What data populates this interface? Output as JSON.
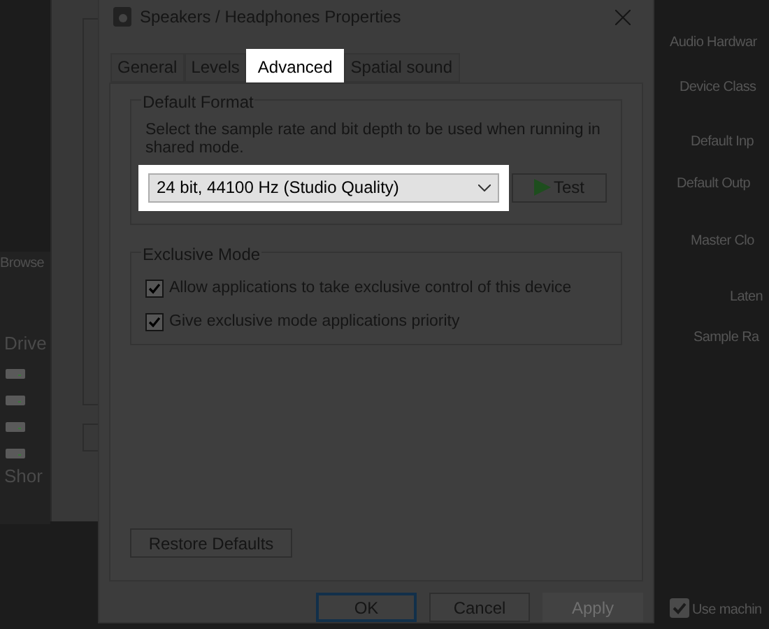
{
  "background_left": {
    "button": "Browse",
    "sidebar_heading": "Drive",
    "drive_count_label": "Shor"
  },
  "dialog": {
    "title": "Speakers / Headphones Properties",
    "tabs": [
      {
        "label": "General",
        "selected": false
      },
      {
        "label": "Levels",
        "selected": false
      },
      {
        "label": "Advanced",
        "selected": true
      },
      {
        "label": "Spatial sound",
        "selected": false
      }
    ],
    "default_format": {
      "heading": "Default Format",
      "description": "Select the sample rate and bit depth to be used when running in shared mode.",
      "format": "24 bit, 44100 Hz (Studio Quality)",
      "test_button": "Test"
    },
    "exclusive_mode": {
      "heading": "Exclusive Mode",
      "options": [
        {
          "label": "Allow applications to take exclusive control of this device",
          "checked": true
        },
        {
          "label": "Give exclusive mode applications priority",
          "checked": true
        }
      ]
    },
    "restore_button": "Restore Defaults",
    "buttons": [
      {
        "label": "OK",
        "disabled": false
      },
      {
        "label": "Cancel",
        "disabled": false
      },
      {
        "label": "Apply",
        "disabled": true
      }
    ]
  },
  "background_right": {
    "heading": "Audio Hardwar",
    "labels": [
      "Device Class",
      "Default Inp",
      "Default Outp",
      "Master Clo",
      "Laten",
      "Sample Ra"
    ],
    "use_machine": {
      "label": "Use machin",
      "checked": true
    }
  }
}
